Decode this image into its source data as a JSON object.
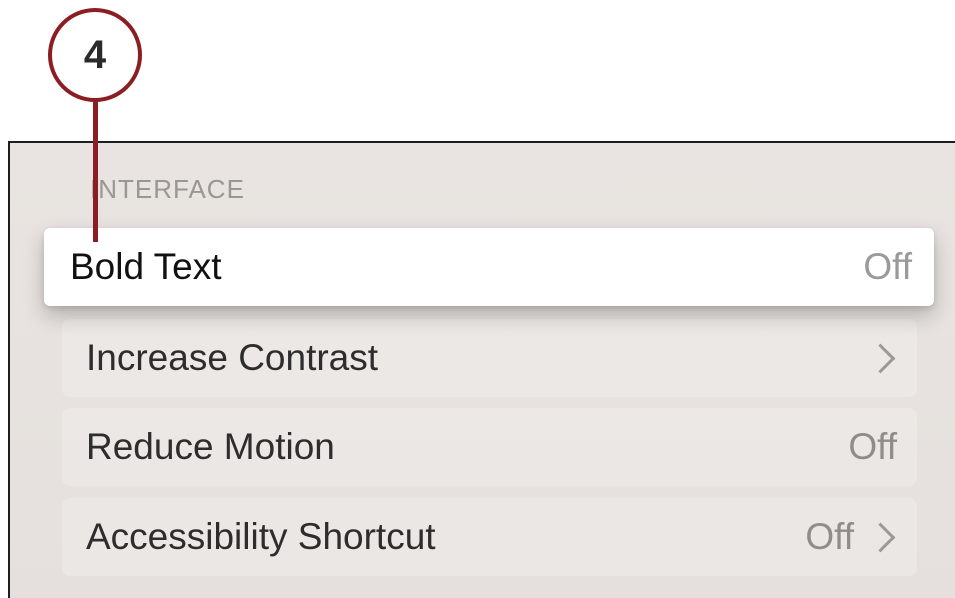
{
  "callout": {
    "number": "4",
    "color": "#8b1e23"
  },
  "section": {
    "header": "INTERFACE"
  },
  "rows": [
    {
      "label": "Bold Text",
      "value": "Off",
      "focused": true,
      "chevron": false
    },
    {
      "label": "Increase Contrast",
      "value": "",
      "focused": false,
      "chevron": true
    },
    {
      "label": "Reduce Motion",
      "value": "Off",
      "focused": false,
      "chevron": false
    },
    {
      "label": "Accessibility Shortcut",
      "value": "Off",
      "focused": false,
      "chevron": true
    }
  ],
  "icons": {
    "chevron": "chevron-right-icon"
  }
}
